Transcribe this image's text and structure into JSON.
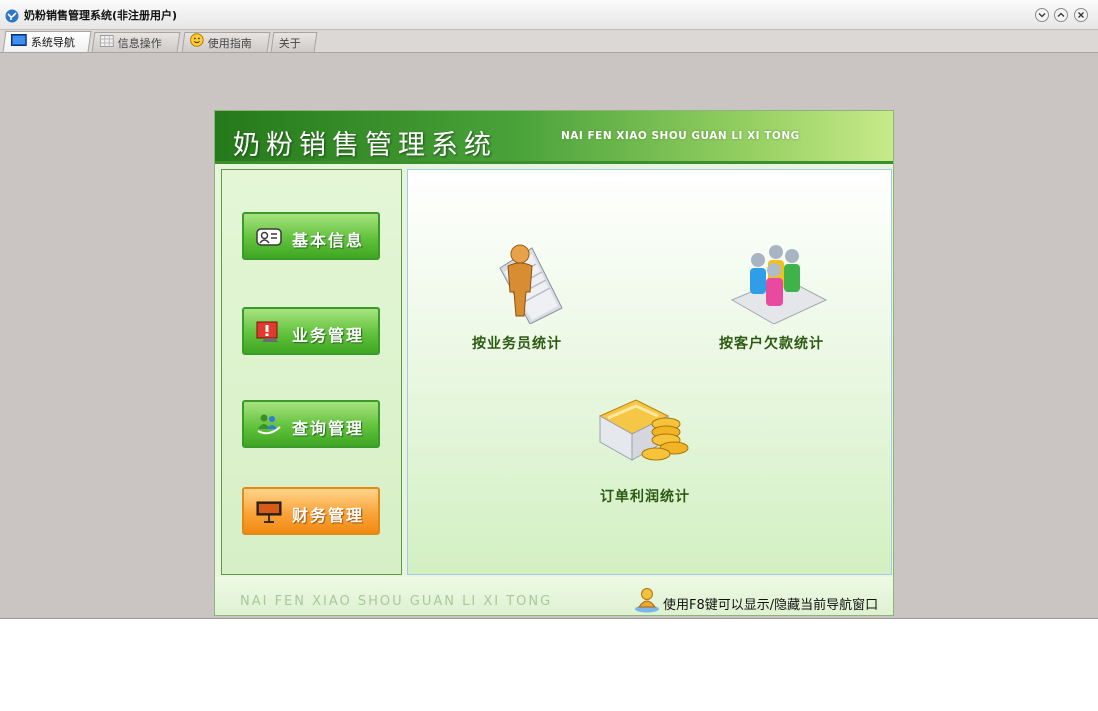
{
  "window": {
    "title": "奶粉销售管理系统(非注册用户)",
    "controls": [
      "chevron-down-icon",
      "chevron-up-icon",
      "close-icon"
    ]
  },
  "tabs": [
    {
      "label": "系统导航",
      "icon": "monitor-icon",
      "active": true
    },
    {
      "label": "信息操作",
      "icon": "grid-icon",
      "active": false
    },
    {
      "label": "使用指南",
      "icon": "smiley-icon",
      "active": false
    },
    {
      "label": "关于",
      "icon": "",
      "active": false
    }
  ],
  "banner": {
    "title": "奶粉销售管理系统",
    "subtitle": "NAI FEN XIAO SHOU GUAN LI XI TONG"
  },
  "nav": {
    "basic_info": "基本信息",
    "business": "业务管理",
    "query": "查询管理",
    "finance": "财务管理"
  },
  "tools": {
    "salesman_stats": "按业务员统计",
    "customer_debt_stats": "按客户欠款统计",
    "order_profit_stats": "订单利润统计"
  },
  "footer": {
    "pinyin": "NAI FEN XIAO SHOU GUAN LI XI TONG",
    "hint": "使用F8键可以显示/隐藏当前导航窗口"
  },
  "colors": {
    "banner_dark": "#25791a",
    "banner_light": "#c7ea8a",
    "button_green": "#62c23d",
    "button_orange": "#f9a43a",
    "window_bg": "#cac5c3"
  }
}
